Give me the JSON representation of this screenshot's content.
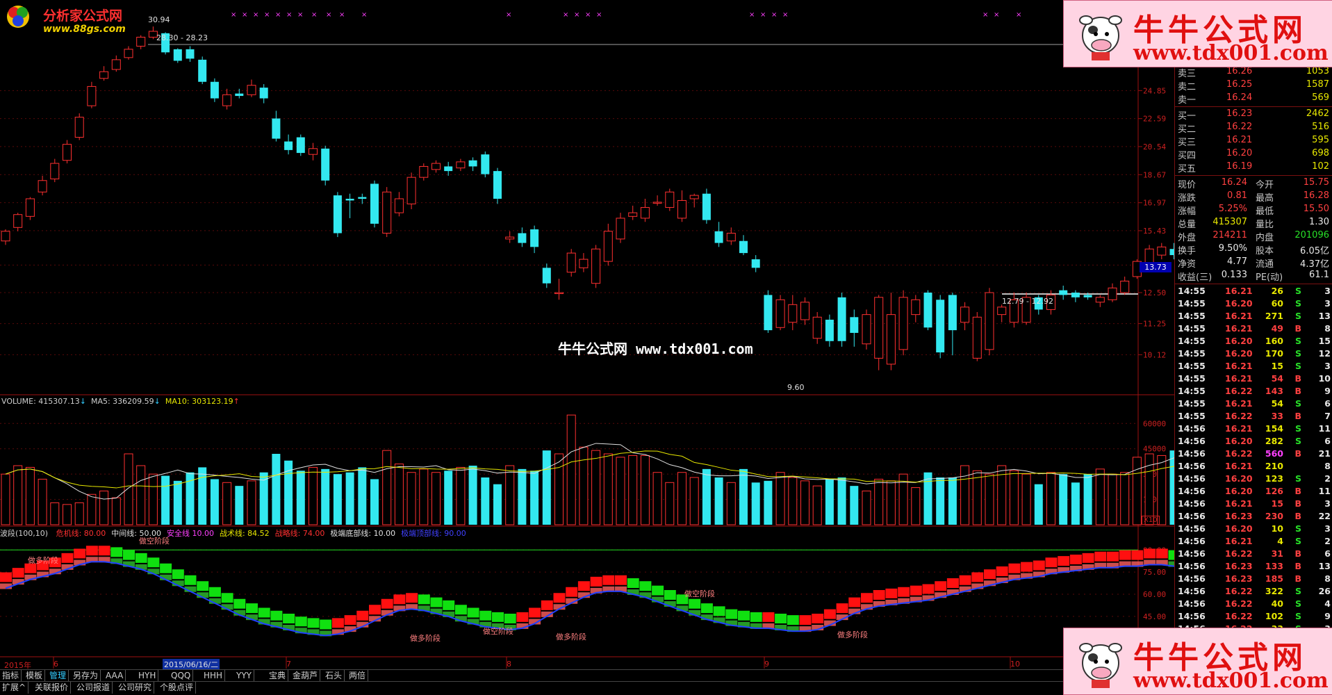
{
  "logo": {
    "name": "分析家公式网",
    "url": "www.88gs.com"
  },
  "watermark": {
    "text": "牛牛公式网 www.tdx001.com"
  },
  "banners": [
    {
      "title": "牛牛公式网",
      "url": "www.tdx001.com"
    },
    {
      "title": "牛牛公式网",
      "url": "www.tdx001.com"
    }
  ],
  "price_panel": {
    "high_label": "30.94",
    "range_top": "28.30 - 28.23",
    "range_mid": "12.79 - 12.92",
    "low_label": "9.60",
    "y_ticks": [
      "24.85",
      "22.59",
      "20.54",
      "18.67",
      "16.97",
      "15.43",
      "13.73",
      "12.50",
      "11.25",
      "10.12"
    ],
    "current_price_marker": "13.73"
  },
  "volume_panel": {
    "title": "VOLUME: 415307.13",
    "ma5": "MA5: 336209.59",
    "ma10": "MA10: 303123.19",
    "y_ticks": [
      "60000",
      "45000",
      "30000",
      "15000"
    ],
    "unit": "X10"
  },
  "indicator_panel": {
    "name": "波段(100,10)",
    "items": [
      {
        "label": "危机线:",
        "value": "80.00",
        "color": "#ff3030"
      },
      {
        "label": "中间线:",
        "value": "50.00",
        "color": "#e0e0e0"
      },
      {
        "label": "安全线",
        "value": "10.00",
        "color": "#ff40ff"
      },
      {
        "label": "战术线:",
        "value": "84.52",
        "color": "#e8e800"
      },
      {
        "label": "战略线:",
        "value": "74.00",
        "color": "#ff3030"
      },
      {
        "label": "极端底部线:",
        "value": "10.00",
        "color": "#e0e0e0"
      },
      {
        "label": "极端顶部线:",
        "value": "90.00",
        "color": "#4040ff"
      }
    ],
    "y_ticks": [
      "90.00",
      "75.00",
      "60.00",
      "45.00"
    ],
    "annotations": [
      "做多阶段",
      "做空阶段",
      "做空阶段",
      "做多阶段",
      "做多阶段",
      "做空阶段",
      "做多阶段"
    ]
  },
  "date_axis": {
    "labels": [
      "2015年",
      "6",
      "2015/06/16/二",
      "7",
      "8",
      "9",
      "10"
    ]
  },
  "bottom_tabs_row1": [
    "指标",
    "模板",
    "管理",
    "另存为",
    "AAA",
    "HYH",
    "QQQ",
    "HHH",
    "YYY",
    "宝典",
    "金葫芦",
    "石头",
    "两倍"
  ],
  "bottom_tabs_row2": [
    "扩展^",
    "关联报价",
    "公司报道",
    "公司研究",
    "个股点评"
  ],
  "quotes": {
    "sells": [
      {
        "label": "卖三",
        "price": "16.26",
        "vol": "1053"
      },
      {
        "label": "卖二",
        "price": "16.25",
        "vol": "1587"
      },
      {
        "label": "卖一",
        "price": "16.24",
        "vol": "569"
      }
    ],
    "buys": [
      {
        "label": "买一",
        "price": "16.23",
        "vol": "2462"
      },
      {
        "label": "买二",
        "price": "16.22",
        "vol": "516"
      },
      {
        "label": "买三",
        "price": "16.21",
        "vol": "595"
      },
      {
        "label": "买四",
        "price": "16.20",
        "vol": "698"
      },
      {
        "label": "买五",
        "price": "16.19",
        "vol": "102"
      }
    ],
    "stats": [
      {
        "l1": "现价",
        "v1": "16.24",
        "l2": "今开",
        "v2": "15.75"
      },
      {
        "l1": "涨跌",
        "v1": "0.81",
        "l2": "最高",
        "v2": "16.28"
      },
      {
        "l1": "涨幅",
        "v1": "5.25%",
        "l2": "最低",
        "v2": "15.50"
      },
      {
        "l1": "总量",
        "v1": "415307",
        "l2": "量比",
        "v2": "1.30"
      },
      {
        "l1": "外盘",
        "v1": "214211",
        "l2": "内盘",
        "v2": "201096"
      },
      {
        "l1": "换手",
        "v1": "9.50%",
        "l2": "股本",
        "v2": "6.05亿"
      },
      {
        "l1": "净资",
        "v1": "4.77",
        "l2": "流通",
        "v2": "4.37亿"
      },
      {
        "l1": "收益(三)",
        "v1": "0.133",
        "l2": "PE(动)",
        "v2": "61.1"
      }
    ],
    "ticks": [
      [
        "14:55",
        "16.21",
        "26",
        "S",
        "3"
      ],
      [
        "14:55",
        "16.20",
        "60",
        "S",
        "3"
      ],
      [
        "14:55",
        "16.21",
        "271",
        "S",
        "13"
      ],
      [
        "14:55",
        "16.21",
        "49",
        "B",
        "8"
      ],
      [
        "14:55",
        "16.20",
        "160",
        "S",
        "15"
      ],
      [
        "14:55",
        "16.20",
        "170",
        "S",
        "12"
      ],
      [
        "14:55",
        "16.21",
        "15",
        "S",
        "3"
      ],
      [
        "14:55",
        "16.21",
        "54",
        "B",
        "10"
      ],
      [
        "14:55",
        "16.22",
        "143",
        "B",
        "9"
      ],
      [
        "14:55",
        "16.21",
        "54",
        "S",
        "6"
      ],
      [
        "14:55",
        "16.22",
        "33",
        "B",
        "7"
      ],
      [
        "14:56",
        "16.21",
        "154",
        "S",
        "11"
      ],
      [
        "14:56",
        "16.20",
        "282",
        "S",
        "6"
      ],
      [
        "14:56",
        "16.22",
        "560",
        "B",
        "21"
      ],
      [
        "14:56",
        "16.21",
        "210",
        "",
        "8"
      ],
      [
        "14:56",
        "16.20",
        "123",
        "S",
        "2"
      ],
      [
        "14:56",
        "16.20",
        "126",
        "B",
        "11"
      ],
      [
        "14:56",
        "16.21",
        "15",
        "B",
        "3"
      ],
      [
        "14:56",
        "16.23",
        "230",
        "B",
        "22"
      ],
      [
        "14:56",
        "16.20",
        "10",
        "S",
        "3"
      ],
      [
        "14:56",
        "16.21",
        "4",
        "S",
        "2"
      ],
      [
        "14:56",
        "16.22",
        "31",
        "B",
        "6"
      ],
      [
        "14:56",
        "16.23",
        "133",
        "B",
        "13"
      ],
      [
        "14:56",
        "16.23",
        "185",
        "B",
        "8"
      ],
      [
        "14:56",
        "16.22",
        "322",
        "S",
        "26"
      ],
      [
        "14:56",
        "16.22",
        "40",
        "S",
        "4"
      ],
      [
        "14:56",
        "16.22",
        "102",
        "S",
        "9"
      ],
      [
        "14:56",
        "16.22",
        "33",
        "S",
        "3"
      ]
    ]
  },
  "chart_data": {
    "type": "candlestick",
    "open": [
      14.9,
      15.6,
      16.2,
      17.6,
      18.4,
      19.6,
      21.2,
      23.6,
      25.9,
      26.7,
      27.8,
      28.9,
      29.8,
      30.2,
      28.6,
      28.6,
      27.6,
      25.6,
      23.6,
      24.6,
      24.5,
      25.1,
      22.6,
      20.9,
      21.2,
      20.0,
      20.4,
      17.4,
      17.2,
      17.3,
      18.1,
      15.3,
      16.4,
      16.9,
      18.5,
      19.0,
      19.2,
      19.1,
      19.6,
      20.0,
      18.9,
      15.0,
      15.3,
      15.5,
      13.6,
      12.5,
      13.4,
      13.6,
      12.9,
      13.9,
      15.0,
      16.2,
      16.1,
      17.0,
      16.7,
      16.1,
      17.2,
      17.5,
      15.4,
      14.9,
      14.9,
      14.0,
      12.4,
      11.1,
      11.3,
      11.4,
      10.7,
      11.4,
      12.3,
      11.5,
      10.5,
      10.0,
      9.8,
      10.3,
      11.6,
      12.5,
      12.2,
      12.4,
      11.3,
      10.0,
      10.3,
      11.6,
      11.3,
      11.3,
      12.3,
      11.8,
      12.6,
      12.5,
      12.4,
      12.1,
      12.2,
      12.5,
      13.2,
      13.7,
      14.2,
      14.5,
      14.6,
      14.9,
      15.2
    ],
    "close": [
      15.4,
      16.3,
      17.2,
      18.3,
      19.4,
      20.7,
      22.7,
      25.2,
      26.5,
      27.6,
      28.6,
      29.8,
      30.4,
      28.3,
      27.5,
      27.7,
      25.6,
      24.2,
      24.5,
      24.4,
      25.3,
      24.2,
      21.1,
      20.3,
      20.1,
      20.4,
      18.3,
      15.3,
      17.1,
      17.2,
      15.8,
      17.6,
      17.2,
      18.5,
      19.2,
      19.4,
      18.9,
      19.5,
      19.2,
      18.7,
      17.2,
      15.1,
      14.8,
      14.6,
      12.9,
      12.5,
      14.3,
      14.0,
      14.5,
      15.4,
      16.1,
      16.4,
      16.7,
      17.0,
      17.6,
      17.1,
      17.4,
      16.0,
      14.8,
      15.3,
      14.3,
      13.6,
      11.0,
      12.2,
      12.0,
      12.1,
      11.5,
      10.6,
      10.6,
      10.9,
      11.6,
      12.3,
      11.6,
      12.3,
      12.2,
      11.1,
      10.2,
      11.0,
      11.9,
      11.5,
      12.5,
      11.9,
      12.2,
      12.3,
      11.8,
      12.4,
      12.4,
      12.3,
      12.3,
      12.3,
      12.7,
      13.0,
      13.9,
      14.5,
      14.6,
      14.2,
      15.0,
      15.4,
      15.9
    ],
    "high": [
      15.5,
      16.4,
      17.3,
      18.6,
      19.7,
      21.0,
      23.0,
      25.6,
      27.0,
      28.0,
      28.9,
      30.0,
      30.9,
      30.3,
      28.7,
      28.9,
      27.9,
      25.9,
      25.0,
      25.0,
      25.8,
      25.4,
      23.2,
      21.4,
      21.4,
      20.8,
      20.6,
      17.6,
      17.5,
      17.5,
      18.3,
      17.9,
      17.6,
      18.8,
      19.4,
      19.6,
      19.5,
      19.7,
      19.8,
      20.2,
      19.1,
      15.4,
      15.6,
      15.7,
      13.8,
      13.1,
      14.5,
      14.3,
      14.7,
      15.8,
      16.4,
      16.8,
      17.2,
      17.4,
      17.8,
      17.7,
      17.5,
      17.8,
      15.9,
      15.6,
      15.2,
      14.2,
      12.6,
      12.4,
      12.4,
      12.3,
      11.7,
      11.6,
      12.5,
      11.8,
      11.8,
      12.4,
      12.5,
      12.6,
      12.4,
      12.6,
      12.4,
      12.5,
      12.1,
      11.7,
      12.7,
      12.0,
      12.5,
      12.5,
      12.4,
      12.6,
      12.8,
      12.6,
      12.5,
      12.4,
      12.9,
      13.2,
      14.0,
      14.7,
      14.8,
      14.8,
      15.2,
      15.6,
      16.3
    ],
    "low": [
      14.7,
      15.4,
      16.0,
      17.4,
      18.2,
      19.4,
      21.0,
      23.4,
      25.7,
      26.5,
      27.6,
      28.6,
      29.6,
      28.1,
      27.3,
      27.4,
      25.4,
      23.9,
      23.3,
      24.2,
      24.3,
      23.8,
      20.9,
      20.0,
      19.9,
      19.6,
      18.0,
      15.1,
      16.1,
      16.9,
      15.6,
      15.1,
      16.2,
      16.6,
      18.3,
      18.8,
      18.6,
      18.9,
      18.9,
      18.5,
      16.9,
      14.8,
      14.6,
      14.3,
      12.7,
      12.2,
      13.2,
      13.4,
      12.7,
      13.7,
      14.8,
      16.0,
      15.9,
      16.8,
      16.5,
      15.9,
      16.7,
      15.8,
      14.6,
      14.7,
      14.2,
      13.4,
      10.9,
      11.0,
      11.0,
      11.2,
      10.5,
      10.4,
      10.4,
      10.4,
      10.3,
      9.6,
      9.6,
      10.1,
      11.3,
      11.0,
      10.0,
      10.1,
      11.0,
      9.9,
      10.1,
      11.3,
      11.1,
      11.2,
      11.6,
      11.6,
      12.2,
      12.1,
      12.2,
      11.9,
      12.1,
      12.4,
      13.1,
      13.6,
      14.0,
      14.0,
      14.5,
      14.8,
      15.1
    ],
    "volume": [
      30000,
      35000,
      34000,
      27000,
      13000,
      12000,
      13000,
      18000,
      20000,
      16000,
      42000,
      35000,
      30000,
      29000,
      26000,
      31000,
      34000,
      27000,
      25000,
      23000,
      26000,
      31000,
      42000,
      38000,
      32000,
      34000,
      33000,
      30000,
      31000,
      34000,
      27000,
      44000,
      36000,
      31000,
      33000,
      31000,
      32000,
      34000,
      35000,
      28000,
      24000,
      35000,
      33000,
      32000,
      44000,
      42000,
      65000,
      46000,
      44000,
      42000,
      40000,
      41000,
      41000,
      31000,
      25000,
      31000,
      28000,
      33000,
      28000,
      25000,
      33000,
      25000,
      26000,
      31000,
      28000,
      26000,
      23000,
      27000,
      28000,
      23000,
      20000,
      27000,
      26000,
      30000,
      22000,
      31000,
      28000,
      28000,
      35000,
      32000,
      30000,
      35000,
      32000,
      30000,
      24000,
      31000,
      30000,
      25000,
      30000,
      33000,
      30000,
      31000,
      40000,
      42000,
      41000,
      44000,
      41000,
      42000,
      41000
    ],
    "ylim": [
      9.0,
      31.5
    ]
  }
}
